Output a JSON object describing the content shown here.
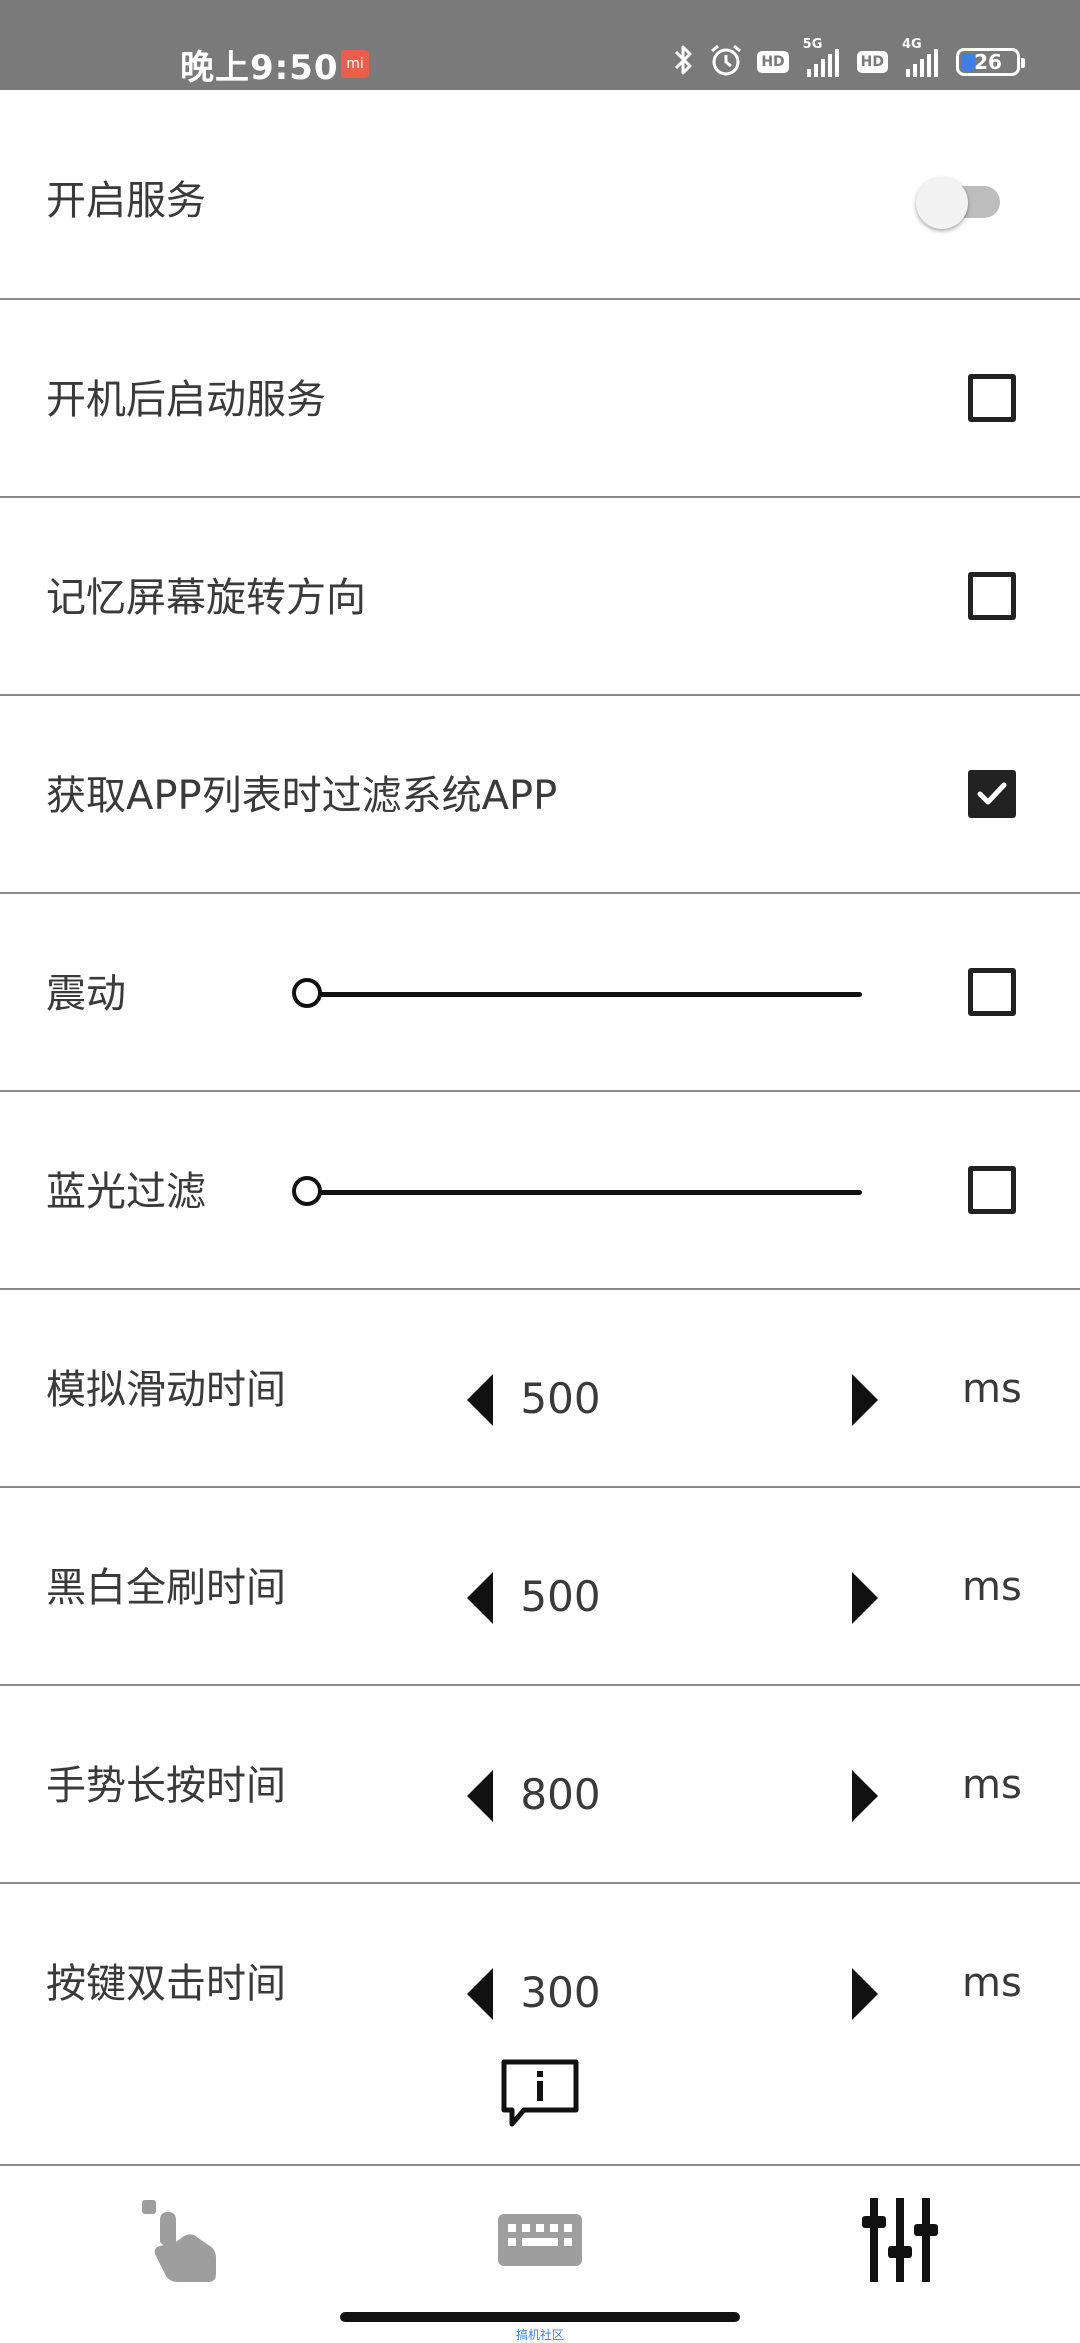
{
  "status_bar": {
    "time": "晚上9:50",
    "mi_badge": "mi",
    "hd1": "HD",
    "net1": "5G",
    "hd2": "HD",
    "net2": "4G",
    "battery_level": "26",
    "battery_percent": 26,
    "battery_color": "#3f7fe8"
  },
  "settings": {
    "service": {
      "label": "开启服务",
      "enabled": false
    },
    "boot_start": {
      "label": "开机后启动服务",
      "checked": false
    },
    "remember_rotation": {
      "label": "记忆屏幕旋转方向",
      "checked": false
    },
    "filter_system_apps": {
      "label": "获取APP列表时过滤系统APP",
      "checked": true
    },
    "vibration": {
      "label": "震动",
      "checked": false,
      "level": 0
    },
    "blue_light": {
      "label": "蓝光过滤",
      "checked": false,
      "level": 0
    },
    "swipe_time": {
      "label": "模拟滑动时间",
      "value": "500",
      "unit": "ms"
    },
    "refresh_time": {
      "label": "黑白全刷时间",
      "value": "500",
      "unit": "ms"
    },
    "long_press_time": {
      "label": "手势长按时间",
      "value": "800",
      "unit": "ms"
    },
    "double_click_time": {
      "label": "按键双击时间",
      "value": "300",
      "unit": "ms"
    }
  },
  "bottom_nav": {
    "items": [
      {
        "icon": "touch-gesture-icon",
        "active": false
      },
      {
        "icon": "keyboard-icon",
        "active": false
      },
      {
        "icon": "sliders-icon",
        "active": true
      }
    ]
  },
  "footer": {
    "text": "搞机社区"
  },
  "colors": {
    "accent": "#3f7fe8",
    "text": "#3a3a3a",
    "divider": "#8a8a8a",
    "status_bar": "#7a7a7a",
    "inactive_icon": "#9e9e9e"
  }
}
